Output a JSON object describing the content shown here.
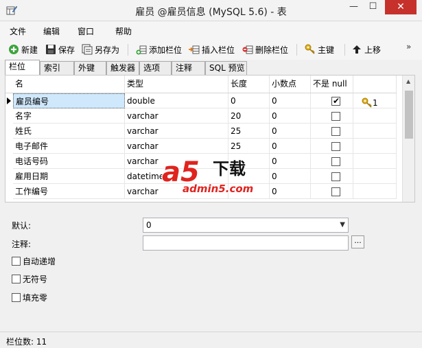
{
  "window": {
    "title": "雇员 @雇员信息 (MySQL 5.6) - 表",
    "min_glyph": "—",
    "max_glyph": "☐",
    "close_glyph": "✕"
  },
  "menu": [
    "文件",
    "编辑",
    "窗口",
    "帮助"
  ],
  "toolbar": {
    "new_label": "新建",
    "save_label": "保存",
    "save_as_label": "另存为",
    "add_column_label": "添加栏位",
    "insert_column_label": "插入栏位",
    "delete_column_label": "删除栏位",
    "primary_key_label": "主键",
    "move_up_label": "上移",
    "overflow_glyph": "»"
  },
  "tabs": [
    "栏位",
    "索引",
    "外键",
    "触发器",
    "选项",
    "注释",
    "SQL 预览"
  ],
  "columns_table": {
    "headers": [
      "名",
      "类型",
      "长度",
      "小数点",
      "不是 null",
      ""
    ],
    "rows": [
      {
        "name": "雇员编号",
        "type": "double",
        "length": "0",
        "decimals": "0",
        "not_null": "✔",
        "key": "1"
      },
      {
        "name": "名字",
        "type": "varchar",
        "length": "20",
        "decimals": "0",
        "not_null": "",
        "key": ""
      },
      {
        "name": "姓氏",
        "type": "varchar",
        "length": "25",
        "decimals": "0",
        "not_null": "",
        "key": ""
      },
      {
        "name": "电子邮件",
        "type": "varchar",
        "length": "25",
        "decimals": "0",
        "not_null": "",
        "key": ""
      },
      {
        "name": "电话号码",
        "type": "varchar",
        "length": "",
        "decimals": "0",
        "not_null": "",
        "key": ""
      },
      {
        "name": "雇用日期",
        "type": "datetime",
        "length": "",
        "decimals": "0",
        "not_null": "",
        "key": ""
      },
      {
        "name": "工作编号",
        "type": "varchar",
        "length": "",
        "decimals": "0",
        "not_null": "",
        "key": ""
      }
    ]
  },
  "watermark": {
    "brand": "a5",
    "suffix": "下载",
    "url": "admin5.com"
  },
  "properties": {
    "default_label": "默认:",
    "default_value": "0",
    "comment_label": "注释:",
    "comment_value": "",
    "browse_label": "...",
    "auto_increment_label": "自动递增",
    "unsigned_label": "无符号",
    "zerofill_label": "填充零"
  },
  "status": {
    "text": "栏位数: 11"
  },
  "colors": {
    "close_button": "#c7312b",
    "selected_cell": "#cfe8fc",
    "key_icon": "#e2b01a",
    "watermark_red": "#e0231e"
  }
}
